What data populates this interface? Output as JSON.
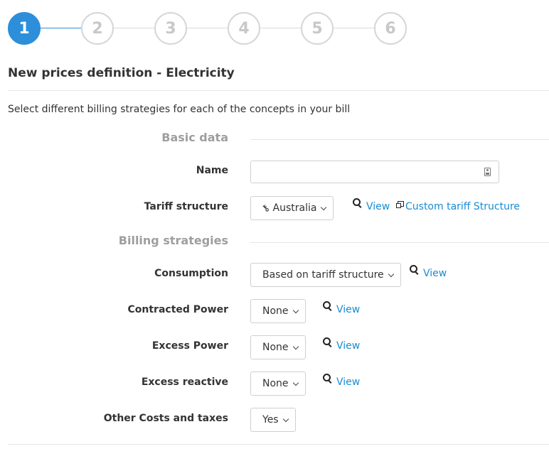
{
  "stepper": {
    "steps": [
      "1",
      "2",
      "3",
      "4",
      "5",
      "6"
    ],
    "active_index": 0
  },
  "page": {
    "title": "New prices definition - Electricity",
    "intro": "Select different billing strategies for each of the concepts in your bill"
  },
  "basic_data": {
    "section_label": "Basic data",
    "name": {
      "label": "Name",
      "value": "",
      "icon": "contact-card-icon"
    },
    "tariff_structure": {
      "label": "Tariff structure",
      "value": "Australia",
      "value_icon": "key-icon",
      "view_label": "View",
      "custom_label": "Custom tariff Structure"
    }
  },
  "billing": {
    "section_label": "Billing strategies",
    "consumption": {
      "label": "Consumption",
      "value": "Based on tariff structure",
      "view_label": "View"
    },
    "contracted_power": {
      "label": "Contracted Power",
      "value": "None",
      "view_label": "View"
    },
    "excess_power": {
      "label": "Excess Power",
      "value": "None",
      "view_label": "View"
    },
    "excess_reactive": {
      "label": "Excess reactive",
      "value": "None",
      "view_label": "View"
    },
    "other_costs": {
      "label": "Other Costs and taxes",
      "value": "Yes"
    }
  },
  "colors": {
    "accent": "#2d8fd9",
    "link": "#1a8bd3",
    "muted": "#9e9e9e"
  }
}
